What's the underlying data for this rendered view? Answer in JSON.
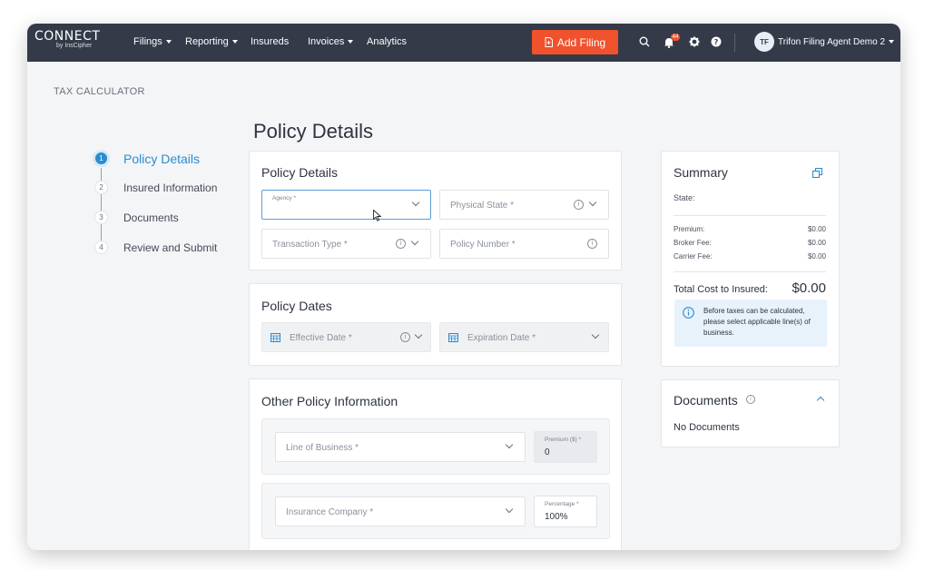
{
  "brand": {
    "name": "CONNECT",
    "sub": "by InsCipher"
  },
  "nav": {
    "filings": "Filings",
    "reporting": "Reporting",
    "insureds": "Insureds",
    "invoices": "Invoices",
    "analytics": "Analytics"
  },
  "header": {
    "add_filing": "Add Filing",
    "notification_count": "44",
    "user_initials": "TF",
    "user_name": "Trifon Filing Agent Demo 2"
  },
  "breadcrumb": "TAX CALCULATOR",
  "page_title": "Policy Details",
  "steps": [
    {
      "num": "1",
      "label": "Policy Details"
    },
    {
      "num": "2",
      "label": "Insured Information"
    },
    {
      "num": "3",
      "label": "Documents"
    },
    {
      "num": "4",
      "label": "Review and Submit"
    }
  ],
  "policy_details": {
    "title": "Policy Details",
    "agency_label": "Agency *",
    "physical_state": "Physical State *",
    "transaction_type": "Transaction Type *",
    "policy_number": "Policy Number *"
  },
  "policy_dates": {
    "title": "Policy Dates",
    "effective_date": "Effective Date *",
    "expiration_date": "Expiration Date *"
  },
  "other_info": {
    "title": "Other Policy Information",
    "line_of_business": "Line of Business *",
    "premium_label": "Premium ($) *",
    "premium_value": "0",
    "insurance_company": "Insurance Company *",
    "percentage_label": "Percentage *",
    "percentage_value": "100%"
  },
  "summary": {
    "title": "Summary",
    "state_label": "State:",
    "premium_label": "Premium:",
    "premium_value": "$0.00",
    "broker_fee_label": "Broker Fee:",
    "broker_fee_value": "$0.00",
    "carrier_fee_label": "Carrier Fee:",
    "carrier_fee_value": "$0.00",
    "total_label": "Total Cost to Insured:",
    "total_value": "$0.00",
    "notice": "Before taxes can be calculated, please select applicable line(s) of business."
  },
  "documents": {
    "title": "Documents",
    "empty": "No Documents"
  },
  "colors": {
    "topbar": "#343a48",
    "accent": "#2a8ccf",
    "add_button": "#f0522e"
  }
}
